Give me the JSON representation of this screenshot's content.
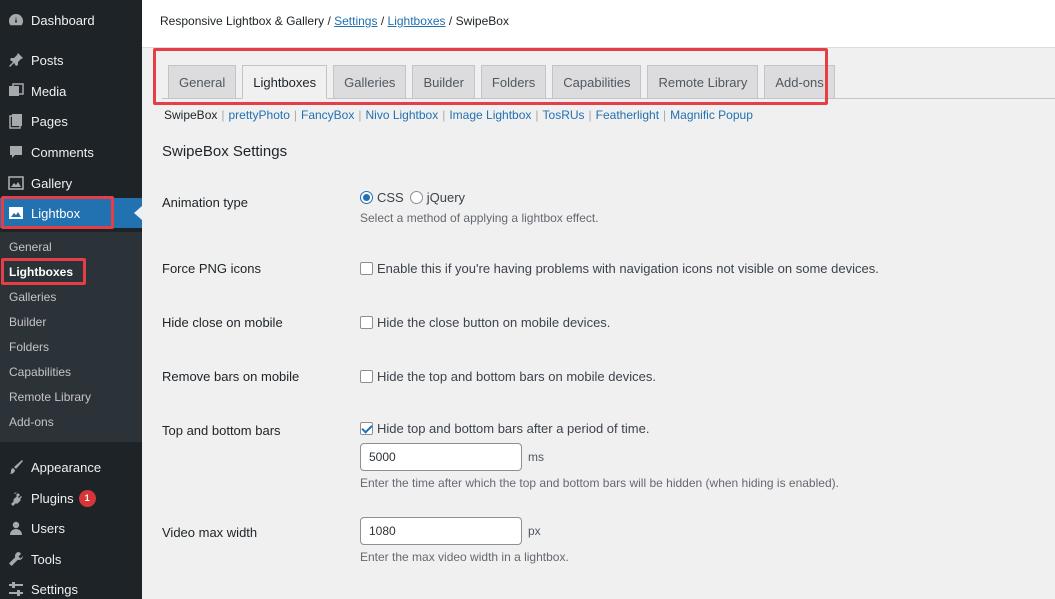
{
  "sidebar": {
    "menu": [
      {
        "label": "Dashboard",
        "icon": "dashboard-icon"
      },
      {
        "label": "Posts",
        "icon": "pin-icon"
      },
      {
        "label": "Media",
        "icon": "media-icon"
      },
      {
        "label": "Pages",
        "icon": "pages-icon"
      },
      {
        "label": "Comments",
        "icon": "comment-icon"
      },
      {
        "label": "Gallery",
        "icon": "gallery-icon"
      },
      {
        "label": "Lightbox",
        "icon": "lightbox-icon"
      }
    ],
    "submenu": [
      "General",
      "Lightboxes",
      "Galleries",
      "Builder",
      "Folders",
      "Capabilities",
      "Remote Library",
      "Add-ons"
    ],
    "menu_bottom": [
      {
        "label": "Appearance",
        "icon": "brush-icon"
      },
      {
        "label": "Plugins",
        "icon": "plugin-icon",
        "badge": "1"
      },
      {
        "label": "Users",
        "icon": "user-icon"
      },
      {
        "label": "Tools",
        "icon": "wrench-icon"
      },
      {
        "label": "Settings",
        "icon": "settings-icon"
      }
    ]
  },
  "breadcrumb": {
    "root": "Responsive Lightbox & Gallery",
    "sep": "/",
    "settings": "Settings",
    "lightboxes": "Lightboxes",
    "current": "SwipeBox"
  },
  "tabs": [
    "General",
    "Lightboxes",
    "Galleries",
    "Builder",
    "Folders",
    "Capabilities",
    "Remote Library",
    "Add-ons"
  ],
  "active_tab": "Lightboxes",
  "subsubsub": [
    "SwipeBox",
    "prettyPhoto",
    "FancyBox",
    "Nivo Lightbox",
    "Image Lightbox",
    "TosRUs",
    "Featherlight",
    "Magnific Popup"
  ],
  "subsubsub_sep": "|",
  "section_title": "SwipeBox Settings",
  "settings": {
    "animation": {
      "label": "Animation type",
      "options": [
        "CSS",
        "jQuery"
      ],
      "selected": "CSS",
      "description": "Select a method of applying a lightbox effect."
    },
    "force_png": {
      "label": "Force PNG icons",
      "checkbox_label": "Enable this if you're having problems with navigation icons not visible on some devices.",
      "checked": false
    },
    "hide_close": {
      "label": "Hide close on mobile",
      "checkbox_label": "Hide the close button on mobile devices.",
      "checked": false
    },
    "remove_bars": {
      "label": "Remove bars on mobile",
      "checkbox_label": "Hide the top and bottom bars on mobile devices.",
      "checked": false
    },
    "top_bottom_bars": {
      "label": "Top and bottom bars",
      "checkbox_label": "Hide top and bottom bars after a period of time.",
      "checked": true,
      "value": "5000",
      "unit": "ms",
      "description": "Enter the time after which the top and bottom bars will be hidden (when hiding is enabled)."
    },
    "video_max_width": {
      "label": "Video max width",
      "value": "1080",
      "unit": "px",
      "description": "Enter the max video width in a lightbox."
    }
  },
  "colors": {
    "sidebar_bg": "#1d2327",
    "submenu_bg": "#2c3338",
    "accent": "#2271b1",
    "highlight_box": "#e53e46",
    "badge": "#d63638"
  }
}
